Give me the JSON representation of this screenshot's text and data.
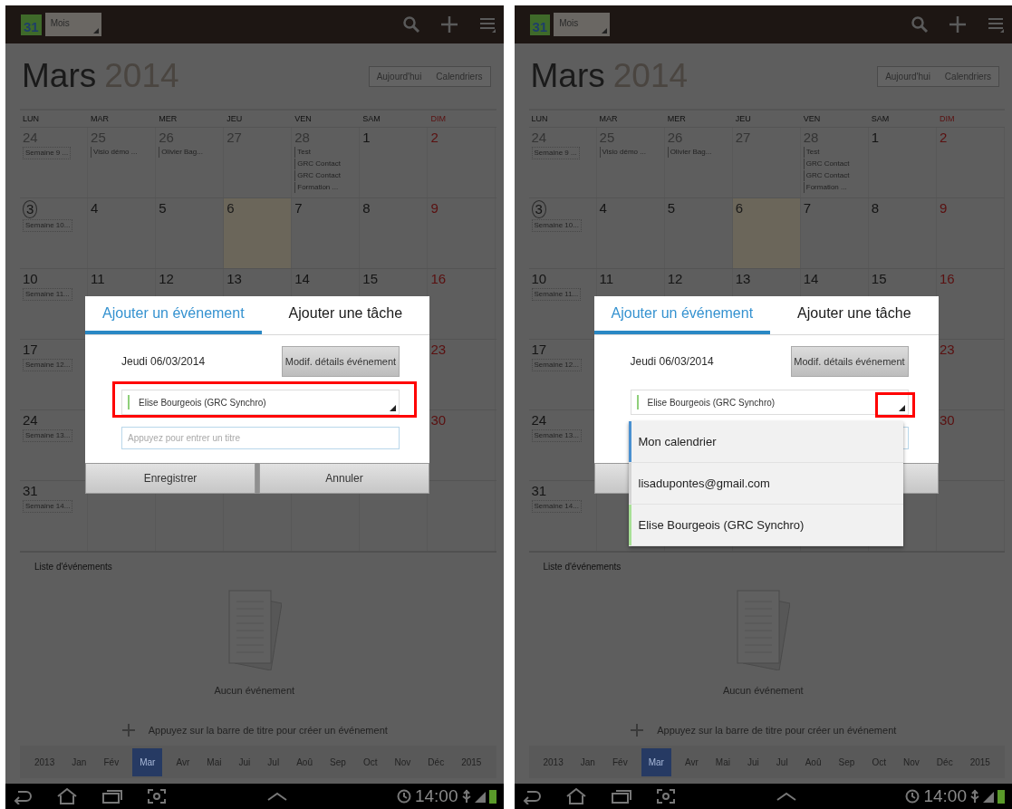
{
  "screens": [
    {
      "action_bar": {
        "date_icon": "31",
        "view": "Mois"
      },
      "month": "Mars",
      "year": "2014",
      "header_buttons": [
        "Aujourd'hui",
        "Calendriers"
      ],
      "weekdays": [
        "LUN",
        "MAR",
        "MER",
        "JEU",
        "VEN",
        "SAM",
        "DIM"
      ],
      "weeks": [
        {
          "label": "Semaine 9 ...",
          "days": [
            {
              "date": "24",
              "other_month": true,
              "selected": false
            },
            {
              "date": "25",
              "other_month": true,
              "selected": false,
              "events": [
                "Visio démo ..."
              ]
            },
            {
              "date": "26",
              "other_month": true,
              "selected": false,
              "events": [
                "Olivier Bag..."
              ]
            },
            {
              "date": "27",
              "other_month": true,
              "selected": false
            },
            {
              "date": "28",
              "other_month": true,
              "selected": false,
              "events": [
                "Test",
                "GRC Contact",
                "GRC Contact",
                "Formation ..."
              ]
            },
            {
              "date": "1",
              "other_month": false,
              "selected": false
            },
            {
              "date": "2",
              "other_month": false,
              "selected": false
            }
          ]
        },
        {
          "label": "Semaine 10...",
          "days": [
            {
              "date": "3",
              "other_month": false,
              "selected": false,
              "today": true
            },
            {
              "date": "4",
              "other_month": false,
              "selected": false
            },
            {
              "date": "5",
              "other_month": false,
              "selected": false
            },
            {
              "date": "6",
              "other_month": false,
              "selected": true
            },
            {
              "date": "7",
              "other_month": false,
              "selected": false
            },
            {
              "date": "8",
              "other_month": false,
              "selected": false
            },
            {
              "date": "9",
              "other_month": false,
              "selected": false
            }
          ]
        },
        {
          "label": "Semaine 11...",
          "days": [
            {
              "date": "10",
              "other_month": false,
              "selected": false
            },
            {
              "date": "11",
              "other_month": false,
              "selected": false
            },
            {
              "date": "12",
              "other_month": false,
              "selected": false
            },
            {
              "date": "13",
              "other_month": false,
              "selected": false
            },
            {
              "date": "14",
              "other_month": false,
              "selected": false
            },
            {
              "date": "15",
              "other_month": false,
              "selected": false
            },
            {
              "date": "16",
              "other_month": false,
              "selected": false
            }
          ]
        },
        {
          "label": "Semaine 12...",
          "first_day": {
            "date": "17",
            "other_month": false,
            "selected": false
          },
          "last_day": {
            "date": "23",
            "other_month": false,
            "selected": false
          }
        },
        {
          "label": "Semaine 13...",
          "first_day": {
            "date": "24",
            "other_month": false,
            "selected": false
          },
          "last_day": {
            "date": "30",
            "other_month": false,
            "selected": false
          }
        },
        {
          "label": "Semaine 14...",
          "first_day": {
            "date": "31",
            "other_month": false,
            "selected": false
          }
        }
      ],
      "list_title": "Liste d'événements",
      "empty_text": "Aucun événement",
      "add_hint": "Appuyez sur la barre de titre pour créer un événement",
      "months": [
        {
          "label": "2013",
          "selected": false
        },
        {
          "label": "Jan",
          "selected": false
        },
        {
          "label": "Fév",
          "selected": false
        },
        {
          "label": "Mar",
          "selected": true
        },
        {
          "label": "Avr",
          "selected": false
        },
        {
          "label": "Mai",
          "selected": false
        },
        {
          "label": "Jui",
          "selected": false
        },
        {
          "label": "Jul",
          "selected": false
        },
        {
          "label": "Aoû",
          "selected": false
        },
        {
          "label": "Sep",
          "selected": false
        },
        {
          "label": "Oct",
          "selected": false
        },
        {
          "label": "Nov",
          "selected": false
        },
        {
          "label": "Déc",
          "selected": false
        },
        {
          "label": "2015",
          "selected": false
        }
      ],
      "clock": "14:00",
      "dialog": {
        "tabs": [
          {
            "label": "Ajouter un événement",
            "selected": true
          },
          {
            "label": "Ajouter une tâche",
            "selected": false
          }
        ],
        "date": "Jeudi 06/03/2014",
        "details_button": "Modif. détails événement",
        "calendar": {
          "value": "Elise Bourgeois (GRC Synchro)",
          "color": "#8fcf7a",
          "highlighted": true,
          "arrow_highlighted": false
        },
        "title_placeholder": "Appuyez pour entrer un titre",
        "buttons": [
          "Enregistrer",
          "Annuler"
        ]
      }
    },
    {
      "action_bar": {
        "date_icon": "31",
        "view": "Mois"
      },
      "month": "Mars",
      "year": "2014",
      "header_buttons": [
        "Aujourd'hui",
        "Calendriers"
      ],
      "weekdays": [
        "LUN",
        "MAR",
        "MER",
        "JEU",
        "VEN",
        "SAM",
        "DIM"
      ],
      "weeks": [
        {
          "label": "Semaine 9 ...",
          "days": [
            {
              "date": "24",
              "other_month": true,
              "selected": false
            },
            {
              "date": "25",
              "other_month": true,
              "selected": false,
              "events": [
                "Visio démo ..."
              ]
            },
            {
              "date": "26",
              "other_month": true,
              "selected": false,
              "events": [
                "Olivier Bag..."
              ]
            },
            {
              "date": "27",
              "other_month": true,
              "selected": false
            },
            {
              "date": "28",
              "other_month": true,
              "selected": false,
              "events": [
                "Test",
                "GRC Contact",
                "GRC Contact",
                "Formation ..."
              ]
            },
            {
              "date": "1",
              "other_month": false,
              "selected": false
            },
            {
              "date": "2",
              "other_month": false,
              "selected": false
            }
          ]
        },
        {
          "label": "Semaine 10...",
          "days": [
            {
              "date": "3",
              "other_month": false,
              "selected": false,
              "today": true
            },
            {
              "date": "4",
              "other_month": false,
              "selected": false
            },
            {
              "date": "5",
              "other_month": false,
              "selected": false
            },
            {
              "date": "6",
              "other_month": false,
              "selected": true
            },
            {
              "date": "7",
              "other_month": false,
              "selected": false
            },
            {
              "date": "8",
              "other_month": false,
              "selected": false
            },
            {
              "date": "9",
              "other_month": false,
              "selected": false
            }
          ]
        },
        {
          "label": "Semaine 11...",
          "days": [
            {
              "date": "10",
              "other_month": false,
              "selected": false
            },
            {
              "date": "11",
              "other_month": false,
              "selected": false
            },
            {
              "date": "12",
              "other_month": false,
              "selected": false
            },
            {
              "date": "13",
              "other_month": false,
              "selected": false
            },
            {
              "date": "14",
              "other_month": false,
              "selected": false
            },
            {
              "date": "15",
              "other_month": false,
              "selected": false
            },
            {
              "date": "16",
              "other_month": false,
              "selected": false
            }
          ]
        },
        {
          "label": "Semaine 12...",
          "first_day": {
            "date": "17",
            "other_month": false,
            "selected": false
          },
          "last_day": {
            "date": "23",
            "other_month": false,
            "selected": false
          }
        },
        {
          "label": "Semaine 13...",
          "first_day": {
            "date": "24",
            "other_month": false,
            "selected": false
          },
          "last_day": {
            "date": "30",
            "other_month": false,
            "selected": false
          }
        },
        {
          "label": "Semaine 14...",
          "first_day": {
            "date": "31",
            "other_month": false,
            "selected": false
          }
        }
      ],
      "list_title": "Liste d'événements",
      "empty_text": "Aucun événement",
      "add_hint": "Appuyez sur la barre de titre pour créer un événement",
      "months": [
        {
          "label": "2013",
          "selected": false
        },
        {
          "label": "Jan",
          "selected": false
        },
        {
          "label": "Fév",
          "selected": false
        },
        {
          "label": "Mar",
          "selected": true
        },
        {
          "label": "Avr",
          "selected": false
        },
        {
          "label": "Mai",
          "selected": false
        },
        {
          "label": "Jui",
          "selected": false
        },
        {
          "label": "Jul",
          "selected": false
        },
        {
          "label": "Aoû",
          "selected": false
        },
        {
          "label": "Sep",
          "selected": false
        },
        {
          "label": "Oct",
          "selected": false
        },
        {
          "label": "Nov",
          "selected": false
        },
        {
          "label": "Déc",
          "selected": false
        },
        {
          "label": "2015",
          "selected": false
        }
      ],
      "clock": "14:00",
      "dialog": {
        "tabs": [
          {
            "label": "Ajouter un événement",
            "selected": true
          },
          {
            "label": "Ajouter une tâche",
            "selected": false
          }
        ],
        "date": "Jeudi 06/03/2014",
        "details_button": "Modif. détails événement",
        "calendar": {
          "value": "Elise Bourgeois (GRC Synchro)",
          "color": "#8fcf7a",
          "highlighted": false,
          "arrow_highlighted": true
        },
        "options": [
          {
            "label": "Mon calendrier",
            "color": "#4a90d0"
          },
          {
            "label": "lisadupontes@gmail.com",
            "color": "#d4d4d4"
          },
          {
            "label": "Elise Bourgeois (GRC Synchro)",
            "color": "#a8e096"
          }
        ]
      }
    }
  ]
}
